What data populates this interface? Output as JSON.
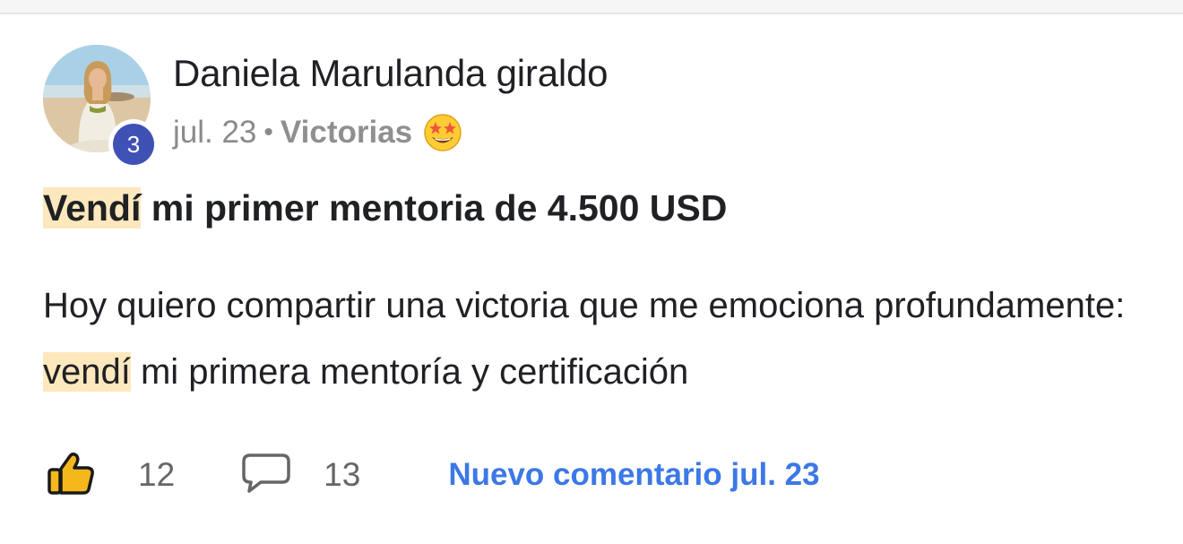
{
  "post": {
    "author_name": "Daniela Marulanda giraldo",
    "author_level": "3",
    "date": "jul. 23",
    "separator": "•",
    "category": "Victorias",
    "category_emoji": "star-struck-emoji",
    "title_highlight": "Vendí",
    "title_rest": " mi primer mentoria de 4.500 USD",
    "body_before": "Hoy quiero compartir una victoria que me emociona profundamente: ",
    "body_highlight": "vendí",
    "body_after": " mi primera mentoría y certificación",
    "likes_count": "12",
    "comments_count": "13",
    "new_comment_label": "Nuevo comentario jul. 23"
  },
  "colors": {
    "text": "#202124",
    "muted": "#8a8a8a",
    "highlight": "#fde8bd",
    "level_badge": "#3f51b5",
    "link": "#3c78e6",
    "like_icon": "#f5b81c"
  },
  "icons": {
    "like": "thumbs-up-icon",
    "comment": "comment-bubble-icon"
  }
}
